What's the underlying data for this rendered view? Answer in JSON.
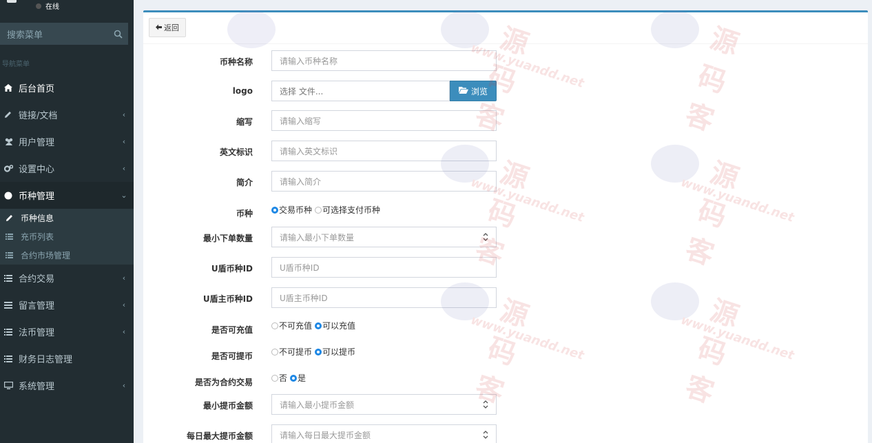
{
  "sidebar": {
    "status": "在线",
    "search_placeholder": "搜索菜单",
    "nav_header": "导航菜单",
    "items": [
      {
        "label": "后台首页",
        "icon": "home-icon",
        "chevron": ""
      },
      {
        "label": "链接/文档",
        "icon": "pencil-icon",
        "chevron": "‹"
      },
      {
        "label": "用户管理",
        "icon": "users-icon",
        "chevron": "‹"
      },
      {
        "label": "设置中心",
        "icon": "cogs-icon",
        "chevron": "‹"
      },
      {
        "label": "币种管理",
        "icon": "circle-icon",
        "chevron": "⌄"
      },
      {
        "label": "合约交易",
        "icon": "list-icon",
        "chevron": "‹"
      },
      {
        "label": "留言管理",
        "icon": "bars-icon",
        "chevron": "‹"
      },
      {
        "label": "法币管理",
        "icon": "list-icon",
        "chevron": "‹"
      },
      {
        "label": "财务日志管理",
        "icon": "list-icon",
        "chevron": ""
      },
      {
        "label": "系统管理",
        "icon": "desktop-icon",
        "chevron": "‹"
      }
    ],
    "submenu": [
      {
        "label": "币种信息",
        "icon": "pencil-icon"
      },
      {
        "label": "充币列表",
        "icon": "list-icon"
      },
      {
        "label": "合约市场管理",
        "icon": "list-icon"
      }
    ]
  },
  "toolbar": {
    "back_label": "返回"
  },
  "form": {
    "name": {
      "label": "币种名称",
      "placeholder": "请输入币种名称"
    },
    "logo": {
      "label": "logo",
      "placeholder": "选择 文件...",
      "browse": "浏览"
    },
    "abbr": {
      "label": "缩写",
      "placeholder": "请输入缩写"
    },
    "en": {
      "label": "英文标识",
      "placeholder": "请输入英文标识"
    },
    "intro": {
      "label": "简介",
      "placeholder": "请输入简介"
    },
    "type": {
      "label": "币种",
      "opt1": "交易币种",
      "opt2": "可选择支付币种"
    },
    "min_order": {
      "label": "最小下单数量",
      "placeholder": "请输入最小下单数量"
    },
    "udun_id": {
      "label": "U盾币种ID",
      "placeholder": "U盾币种ID"
    },
    "udun_main_id": {
      "label": "U盾主币种ID",
      "placeholder": "U盾主币种ID"
    },
    "recharge": {
      "label": "是否可充值",
      "opt1": "不可充值",
      "opt2": "可以充值"
    },
    "withdraw": {
      "label": "是否可提币",
      "opt1": "不可提币",
      "opt2": "可以提币"
    },
    "contract": {
      "label": "是否为合约交易",
      "opt1": "否",
      "opt2": "是"
    },
    "min_withdraw": {
      "label": "最小提币金额",
      "placeholder": "请输入最小提币金额"
    },
    "daily_max": {
      "label": "每日最大提币金额",
      "placeholder": "请输入每日最大提币金额"
    }
  },
  "watermark": {
    "brand": "源码客",
    "url": "www.yuandd.net"
  }
}
